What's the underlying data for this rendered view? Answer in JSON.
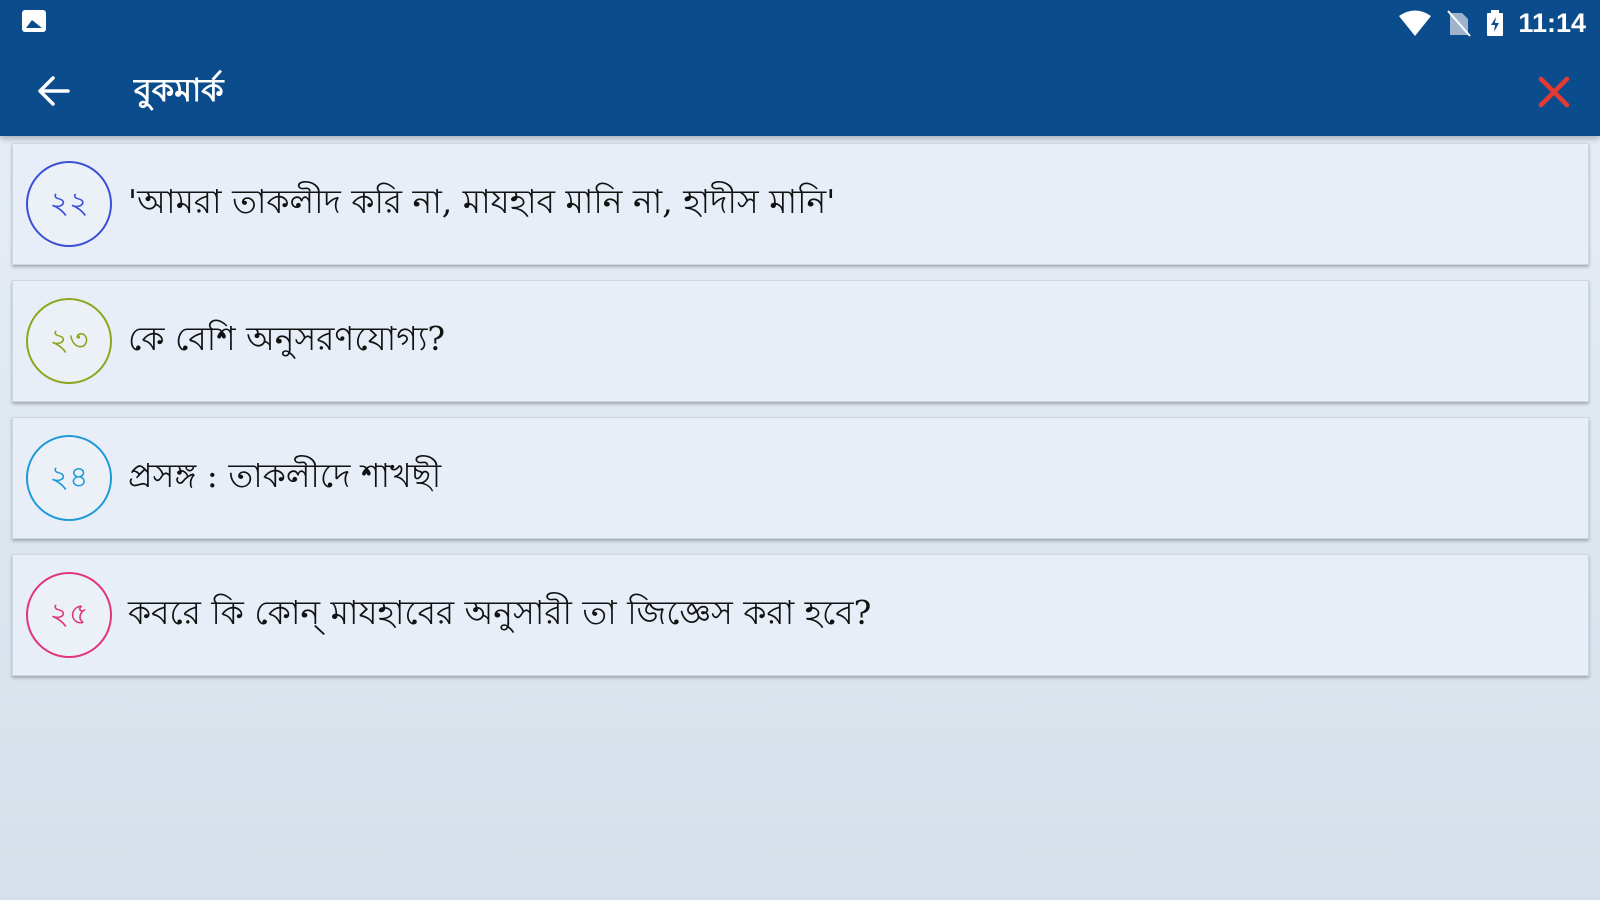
{
  "status_bar": {
    "left_icon": "image-icon",
    "icons": [
      "wifi-icon",
      "no-sim-icon",
      "battery-icon"
    ],
    "time": "11:14"
  },
  "app_bar": {
    "back_icon": "arrow-left-icon",
    "title": "বুকমার্ক",
    "close_icon": "close-icon",
    "close_color": "#e53935"
  },
  "colors": {
    "primary": "#0b4d8c",
    "card_background": "#e7eef7"
  },
  "bookmarks": [
    {
      "number": "২২",
      "title": "'আমরা তাকলীদ করি না, মাযহাব মানি না, হাদীস মানি'",
      "color": "#3a4fd8"
    },
    {
      "number": "২৩",
      "title": "কে বেশি অনুসরণযোগ্য?",
      "color": "#8fa51f"
    },
    {
      "number": "২৪",
      "title": "প্রসঙ্গ : তাকলীদে শাখছী",
      "color": "#1e9ad8"
    },
    {
      "number": "২৫",
      "title": "কবরে কি কোন্ মাযহাবের অনুসারী তা জিজ্ঞেস করা হবে?",
      "color": "#e0357a"
    }
  ]
}
